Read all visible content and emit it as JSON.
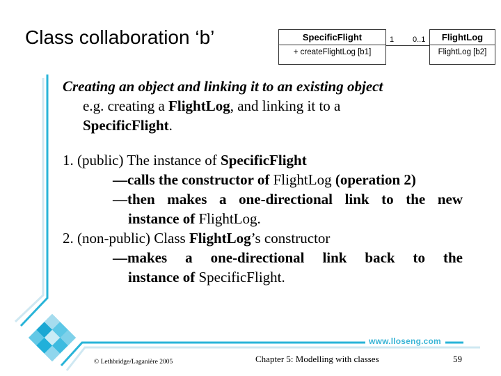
{
  "slide": {
    "title": "Class collaboration ‘b’",
    "accent_color": "#29b4d8",
    "light_accent_color": "#cfe8f2"
  },
  "diagram": {
    "class_left": {
      "name": "SpecificFlight",
      "operation": "+ createFlightLog [b1]"
    },
    "class_right": {
      "name": "FlightLog",
      "operation": "FlightLog [b2]"
    },
    "multiplicity_left": "1",
    "multiplicity_right": "0..1"
  },
  "content": {
    "heading": "Creating an object and linking it to an existing object",
    "example": {
      "prefix": "e.g. creating a ",
      "bold1": "FlightLog",
      "middle": ", and linking it to a",
      "bold2": "SpecificFlight",
      "suffix": "."
    },
    "items": [
      {
        "lead": "1. (public) The instance of ",
        "lead_bold": "SpecificFlight",
        "subs": [
          {
            "b1": "—calls the constructor of ",
            "n1": "FlightLog",
            "b2": " (operation 2)"
          },
          {
            "b1": "—then makes a one-directional link to the new",
            "cont_b": "instance of ",
            "cont_n": "FlightLog",
            "cont_end": "."
          }
        ]
      },
      {
        "lead": "2. (non-public) Class ",
        "lead_bold": "FlightLog",
        "lead_tail": "’s constructor",
        "subs": [
          {
            "b1": "—makes a one-directional link back to the",
            "cont_b": "instance of ",
            "cont_n": "SpecificFlight",
            "cont_end": "."
          }
        ]
      }
    ]
  },
  "footer": {
    "copyright": "© Lethbridge/Laganière 2005",
    "chapter": "Chapter 5: Modelling with classes",
    "page_number": "59",
    "url": "www.lloseng.com"
  }
}
